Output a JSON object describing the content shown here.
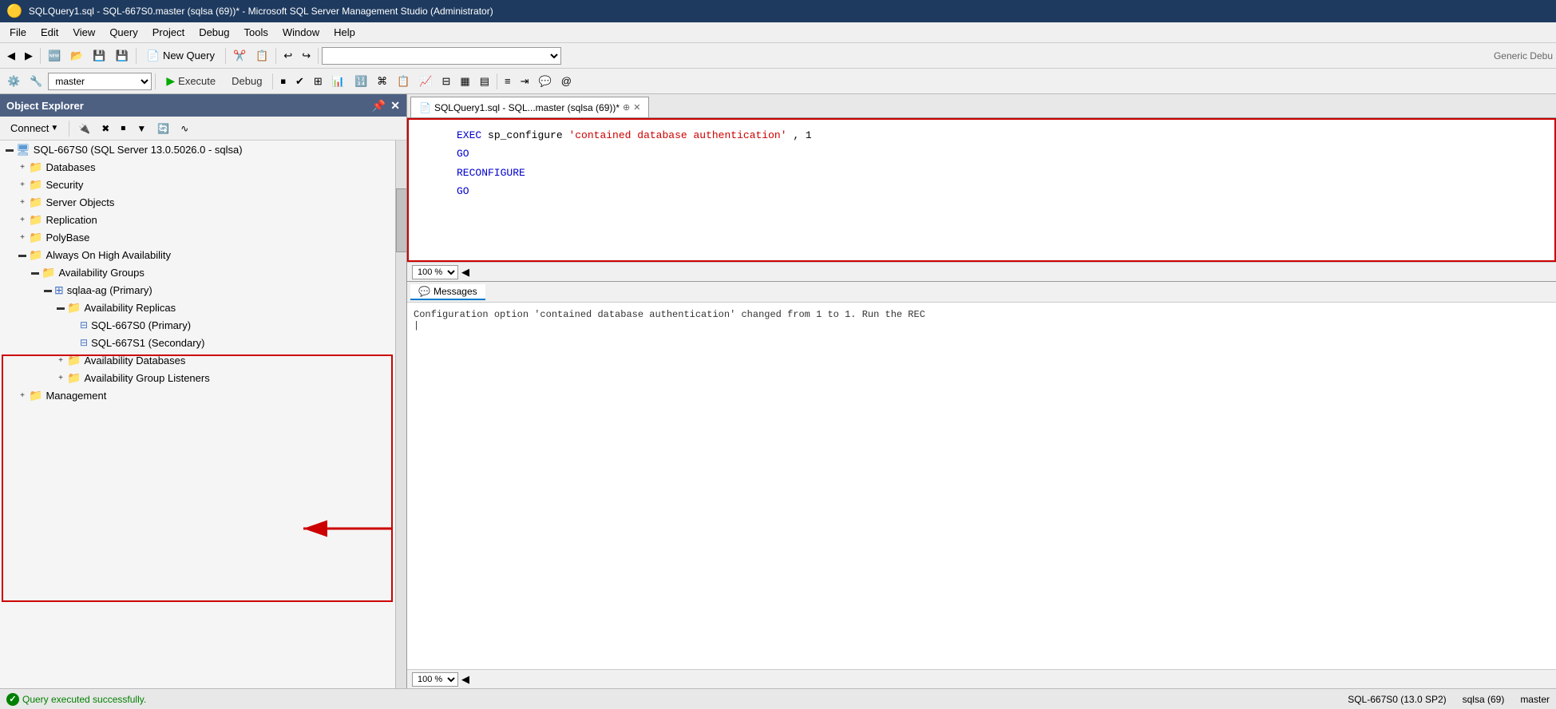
{
  "titleBar": {
    "title": "SQLQuery1.sql - SQL-667S0.master (sqlsa (69))* - Microsoft SQL Server Management Studio (Administrator)",
    "icon": "🟡"
  },
  "menuBar": {
    "items": [
      "File",
      "Edit",
      "View",
      "Query",
      "Project",
      "Debug",
      "Tools",
      "Window",
      "Help"
    ]
  },
  "toolbar": {
    "newQueryLabel": "New Query",
    "genericDebugLabel": "Generic Debu"
  },
  "toolbar2": {
    "database": "master",
    "executeLabel": "Execute",
    "debugLabel": "Debug"
  },
  "objectExplorer": {
    "title": "Object Explorer",
    "connectLabel": "Connect",
    "server": {
      "name": "SQL-667S0 (SQL Server 13.0.5026.0 - sqlsa)",
      "expanded": true,
      "children": [
        {
          "id": "databases",
          "label": "Databases",
          "type": "folder",
          "expanded": false,
          "indent": 1
        },
        {
          "id": "security",
          "label": "Security",
          "type": "folder",
          "expanded": false,
          "indent": 1
        },
        {
          "id": "serverObjects",
          "label": "Server Objects",
          "type": "folder",
          "expanded": false,
          "indent": 1
        },
        {
          "id": "replication",
          "label": "Replication",
          "type": "folder",
          "expanded": false,
          "indent": 1
        },
        {
          "id": "polybase",
          "label": "PolyBase",
          "type": "folder",
          "expanded": false,
          "indent": 1
        },
        {
          "id": "alwaysOn",
          "label": "Always On High Availability",
          "type": "folder",
          "expanded": true,
          "indent": 1,
          "highlighted": true
        },
        {
          "id": "availGroups",
          "label": "Availability Groups",
          "type": "folder",
          "expanded": true,
          "indent": 2,
          "highlighted": true
        },
        {
          "id": "sqlaaAg",
          "label": "sqlaa-ag (Primary)",
          "type": "ag",
          "expanded": true,
          "indent": 3,
          "highlighted": true
        },
        {
          "id": "availReplicas",
          "label": "Availability Replicas",
          "type": "folder",
          "expanded": true,
          "indent": 4,
          "highlighted": true
        },
        {
          "id": "replica1",
          "label": "SQL-667S0 (Primary)",
          "type": "replica",
          "indent": 5,
          "highlighted": true,
          "arrow": true
        },
        {
          "id": "replica2",
          "label": "SQL-667S1 (Secondary)",
          "type": "replica",
          "indent": 5,
          "highlighted": true
        },
        {
          "id": "availDbs",
          "label": "Availability Databases",
          "type": "folder",
          "expanded": false,
          "indent": 4,
          "highlighted": true
        },
        {
          "id": "availListeners",
          "label": "Availability Group Listeners",
          "type": "folder",
          "expanded": false,
          "indent": 4,
          "highlighted": true
        },
        {
          "id": "management",
          "label": "Management",
          "type": "folder",
          "expanded": false,
          "indent": 1
        }
      ]
    }
  },
  "queryEditor": {
    "tabLabel": "SQLQuery1.sql - SQL...master (sqlsa (69))*",
    "code": {
      "line1_keyword1": "EXEC",
      "line1_proc": "sp_configure",
      "line1_string": "'contained database authentication'",
      "line1_value": ", 1",
      "line2": "GO",
      "line3_keyword": "RECONFIGURE",
      "line4": "GO"
    },
    "zoom": "100 %"
  },
  "resultsPanel": {
    "tabLabel": "Messages",
    "message": "Configuration option 'contained database authentication' changed from 1 to 1. Run the REC",
    "zoom": "100 %"
  },
  "statusBar": {
    "successMessage": "Query executed successfully.",
    "serverInfo": "SQL-667S0 (13.0 SP2)",
    "user": "sqlsa (69)",
    "database": "master"
  }
}
